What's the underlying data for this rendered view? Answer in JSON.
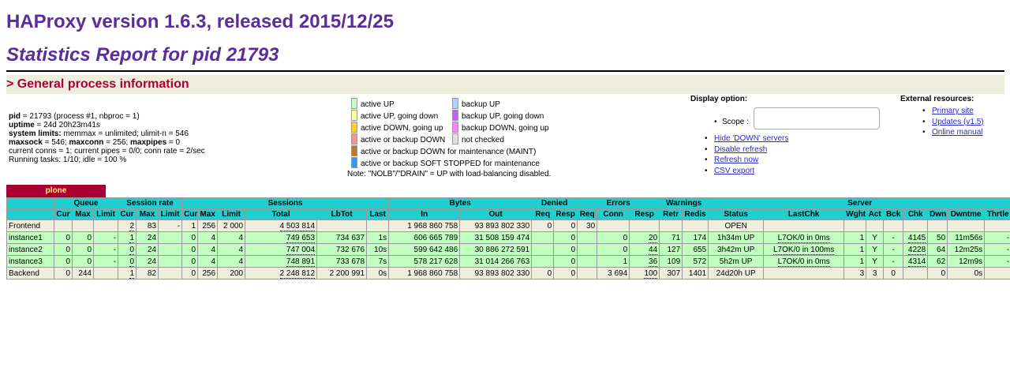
{
  "header": {
    "title": "HAProxy version 1.6.3, released 2015/12/25",
    "subtitle": "Statistics Report for pid 21793"
  },
  "section_title": "> General process information",
  "process_info": {
    "pid_label": "pid",
    "pid_value": " = 21793 (process #1, nbproc = 1)",
    "uptime_label": "uptime",
    "uptime_value": " = 24d 20h23m41s",
    "limits_label": "system limits:",
    "limits_value": " memmax = unlimited; ulimit-n = 546",
    "maxsock_label": "maxsock",
    "maxsock_value": " = 546; ",
    "maxconn_label": "maxconn",
    "maxconn_value": " = 256; ",
    "maxpipes_label": "maxpipes",
    "maxpipes_value": " = 0",
    "current_line": "current conns = 1; current pipes = 0/0; conn rate = 2/sec",
    "tasks_line": "Running tasks: 1/10; idle = 100 %"
  },
  "legend": {
    "left": [
      {
        "label": "active UP",
        "color": "#c0ffc0"
      },
      {
        "label": "active UP, going down",
        "color": "#ffffa0"
      },
      {
        "label": "active DOWN, going up",
        "color": "#ffd020"
      },
      {
        "label": "active or backup DOWN",
        "color": "#ff9090"
      },
      {
        "label": "active or backup DOWN for maintenance (MAINT)",
        "color": "#c07820"
      },
      {
        "label": "active or backup SOFT STOPPED for maintenance",
        "color": "#3399ff"
      }
    ],
    "right": [
      {
        "label": "backup UP",
        "color": "#b0d0ff"
      },
      {
        "label": "backup UP, going down",
        "color": "#c060ff"
      },
      {
        "label": "backup DOWN, going up",
        "color": "#ff80ff"
      },
      {
        "label": "not checked",
        "color": "#e0e0e0"
      }
    ],
    "note": "Note: \"NOLB\"/\"DRAIN\" = UP with load-balancing disabled."
  },
  "display": {
    "title": "Display option:",
    "scope_label": "Scope :",
    "scope_value": "",
    "links": [
      "Hide 'DOWN' servers",
      "Disable refresh",
      "Refresh now",
      "CSV export"
    ]
  },
  "external": {
    "title": "External resources:",
    "links": [
      "Primary site",
      "Updates (v1.5)",
      "Online manual"
    ]
  },
  "proxy": {
    "name": "plone",
    "group_headers": [
      "Queue",
      "Session rate",
      "Sessions",
      "Bytes",
      "Denied",
      "Errors",
      "Warnings",
      "Server"
    ],
    "col_headers": [
      "Cur",
      "Max",
      "Limit",
      "Cur",
      "Max",
      "Limit",
      "Cur",
      "Max",
      "Limit",
      "Total",
      "LbTot",
      "Last",
      "In",
      "Out",
      "Req",
      "Resp",
      "Req",
      "Conn",
      "Resp",
      "Retr",
      "Redis",
      "Status",
      "LastChk",
      "Wght",
      "Act",
      "Bck",
      "Chk",
      "Dwn",
      "Dwntme",
      "Thrtle"
    ],
    "rows": [
      {
        "name": "Frontend",
        "cells": [
          "",
          "",
          "",
          "2",
          "83",
          "-",
          "1",
          "256",
          "2 000",
          "4 503 814",
          "",
          "",
          "1 968 860 758",
          "93 893 802 330",
          "0",
          "0",
          "30",
          "",
          "",
          "",
          "",
          "OPEN",
          "",
          "",
          "",
          "",
          "",
          "",
          "",
          ""
        ]
      },
      {
        "name": "instance1",
        "cells": [
          "0",
          "0",
          "-",
          "1",
          "24",
          "",
          "0",
          "4",
          "4",
          "749 653",
          "734 637",
          "1s",
          "606 665 789",
          "31 508 159 474",
          "",
          "0",
          "",
          "0",
          "20",
          "71",
          "174",
          "1h34m UP",
          "L7OK/0 in 0ms",
          "1",
          "Y",
          "-",
          "4145",
          "50",
          "11m56s",
          "-"
        ]
      },
      {
        "name": "instance2",
        "cells": [
          "0",
          "0",
          "-",
          "0",
          "24",
          "",
          "0",
          "4",
          "4",
          "747 004",
          "732 676",
          "10s",
          "599 642 486",
          "30 886 272 591",
          "",
          "0",
          "",
          "0",
          "44",
          "127",
          "655",
          "3h42m UP",
          "L7OK/0 in 100ms",
          "1",
          "Y",
          "-",
          "4228",
          "64",
          "12m25s",
          "-"
        ]
      },
      {
        "name": "instance3",
        "cells": [
          "0",
          "0",
          "-",
          "0",
          "24",
          "",
          "0",
          "4",
          "4",
          "748 891",
          "733 678",
          "7s",
          "578 217 628",
          "31 014 266 763",
          "",
          "0",
          "",
          "1",
          "36",
          "109",
          "572",
          "5h2m UP",
          "L7OK/0 in 0ms",
          "1",
          "Y",
          "-",
          "4314",
          "62",
          "12m9s",
          "-"
        ]
      },
      {
        "name": "Backend",
        "cells": [
          "0",
          "244",
          "",
          "1",
          "82",
          "",
          "0",
          "256",
          "200",
          "2 248 812",
          "2 200 991",
          "0s",
          "1 968 860 758",
          "93 893 802 330",
          "0",
          "0",
          "",
          "3 694",
          "100",
          "307",
          "1401",
          "24d20h UP",
          "",
          "3",
          "3",
          "0",
          "",
          "0",
          "0s",
          ""
        ]
      }
    ]
  }
}
